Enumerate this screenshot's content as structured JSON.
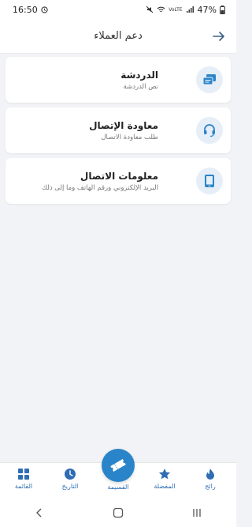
{
  "status_bar": {
    "time": "16:50",
    "battery": "47%",
    "network": "VoLTE"
  },
  "header": {
    "title": "دعم العملاء",
    "back_icon": "arrow-right-icon"
  },
  "options": [
    {
      "title": "الدردشة",
      "subtitle": "نص الدردشة",
      "icon": "chat-icon"
    },
    {
      "title": "معاودة الإتصال",
      "subtitle": "طلب معاودة الاتصال",
      "icon": "headset-icon"
    },
    {
      "title": "معلومات الاتصال",
      "subtitle": "البريد الإلكتروني ورقم الهاتف وما إلى ذلك",
      "icon": "phone-icon"
    }
  ],
  "bottom_nav": {
    "items": [
      {
        "label": "رائج",
        "icon": "fire-icon"
      },
      {
        "label": "المفضلة",
        "icon": "star-icon"
      },
      {
        "label": "القسيمة",
        "icon": "ticket-icon"
      },
      {
        "label": "التاريخ",
        "icon": "clock-icon"
      },
      {
        "label": "القائمة",
        "icon": "grid-icon"
      }
    ]
  },
  "colors": {
    "accent": "#2a84c9",
    "icon_bg": "#e6eef7",
    "page_bg": "#f2f3f6"
  }
}
